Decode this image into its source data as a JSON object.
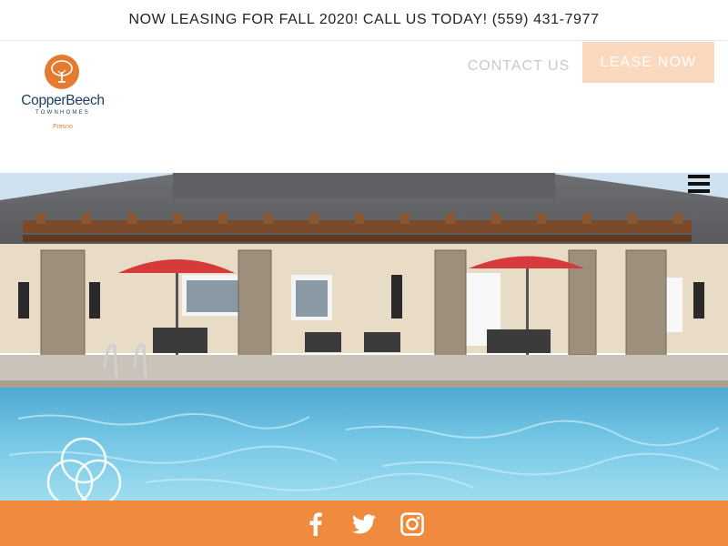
{
  "announcement": "NOW LEASING FOR FALL 2020! CALL US TODAY! (559) 431-7977",
  "logo": {
    "name": "CopperBeech",
    "subtitle": "TOWNHOMES",
    "city": "Fresno",
    "icon": "tree-icon"
  },
  "nav": {
    "contact": "CONTACT US",
    "lease": "LEASE NOW",
    "menu_icon": "hamburger-menu-icon"
  },
  "hero": {
    "image": "pool-pergola-clubhouse-photo"
  },
  "footer": {
    "social": [
      "facebook-icon",
      "twitter-icon",
      "instagram-icon"
    ]
  },
  "colors": {
    "accent": "#ef8a3e",
    "lease_button": "#fbd9bf",
    "logo_navy": "#1c3d63",
    "pool": "#6fc3e2"
  }
}
